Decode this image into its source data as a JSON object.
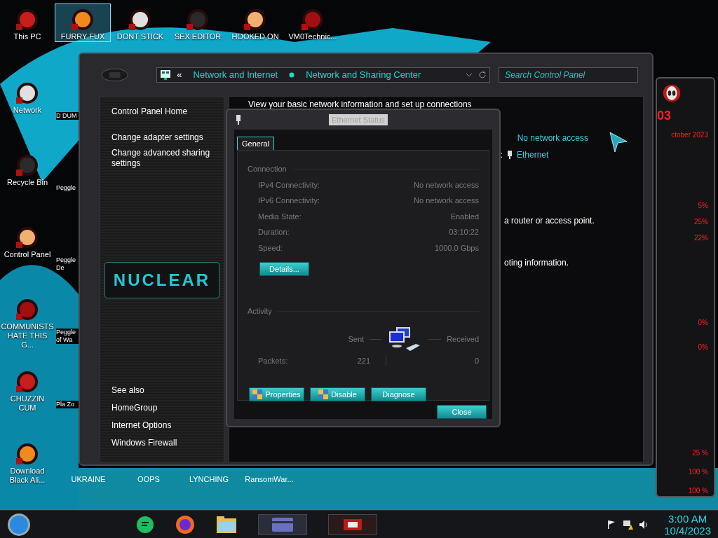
{
  "desktop": {
    "top_icons": [
      {
        "label": "This PC",
        "selected": false
      },
      {
        "label": "FURRY FUX",
        "selected": true
      },
      {
        "label": "DONT STICK",
        "selected": false
      },
      {
        "label": "SEX EDITOR",
        "selected": false
      },
      {
        "label": "HOOKED ON",
        "selected": false
      },
      {
        "label": "VM0Technic...",
        "selected": false
      }
    ],
    "left_icons": [
      {
        "label": "Network"
      },
      {
        "label": "Recycle Bin"
      },
      {
        "label": "Control Panel"
      },
      {
        "label": "COMMUNISTS HATE THIS G..."
      },
      {
        "label": "CHUZZIN CUM"
      },
      {
        "label": "Download Black Ali..."
      }
    ],
    "second_column": [
      {
        "label": "D DUM"
      },
      {
        "label": "Peggle"
      },
      {
        "label": "Peggle De"
      },
      {
        "label": "Peggle of Wa"
      },
      {
        "label": "Pla Zo"
      }
    ],
    "bottom_labels": [
      "UKRAINE",
      "OOPS",
      "LYNCHING",
      "RansomWar..."
    ]
  },
  "window": {
    "breadcrumb": {
      "back": "«",
      "items": [
        "Network and Internet",
        "Network and Sharing Center"
      ]
    },
    "search": {
      "placeholder": "Search Control Panel"
    },
    "sidebar": {
      "links": [
        "Control Panel Home",
        "Change adapter settings",
        "Change advanced sharing settings"
      ],
      "logo": "NUCLEAR",
      "see_also_title": "See also",
      "see_also": [
        "HomeGroup",
        "Internet Options",
        "Windows Firewall"
      ]
    },
    "heading": "View your basic network information and set up connections",
    "access_type": "No network access",
    "connections_label": ":",
    "connection": "Ethernet",
    "texts": [
      "a router or access point.",
      "oting information."
    ]
  },
  "dialog": {
    "title": "Ethernet Status",
    "tabs": [
      {
        "label": "General",
        "selected": true
      }
    ],
    "connection": {
      "title": "Connection",
      "rows": [
        {
          "label": "IPv4 Connectivity:",
          "value": "No network access"
        },
        {
          "label": "IPv6 Connectivity:",
          "value": "No network access"
        },
        {
          "label": "Media State:",
          "value": "Enabled"
        },
        {
          "label": "Duration:",
          "value": "03:10:22"
        },
        {
          "label": "Speed:",
          "value": "1000.0 Gbps"
        }
      ],
      "details_button": "Details..."
    },
    "activity": {
      "title": "Activity",
      "sent": "Sent",
      "received": "Received",
      "packets_label": "Packets:",
      "packets_sent": "221",
      "packets_received": "0"
    },
    "buttons": [
      "Properties",
      "Disable",
      "Diagnose"
    ],
    "close": "Close"
  },
  "gadget": {
    "day": "03",
    "month": "ctober 2023",
    "readings": [
      "5%",
      "25%",
      "22%",
      "0%",
      "0%",
      "25 %",
      "100 %",
      "100 %"
    ]
  },
  "taskbar": {
    "time": "3:00 AM",
    "date": "10/4/2023"
  }
}
